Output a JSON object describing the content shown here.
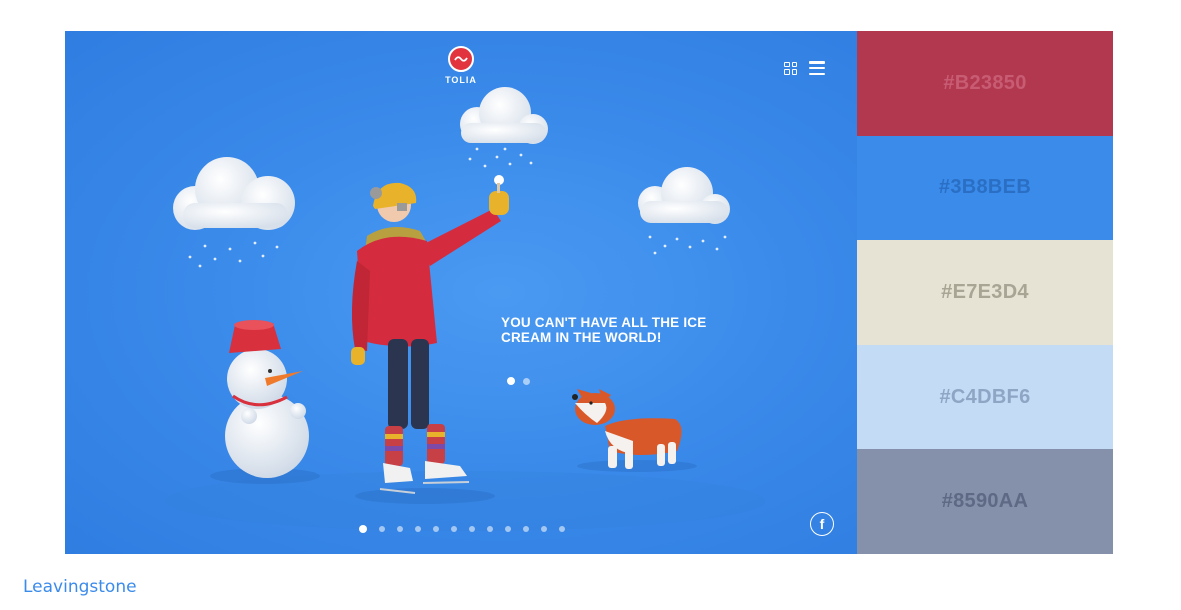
{
  "hero": {
    "brand": "TOLIA",
    "headline": "YOU CAN'T HAVE ALL THE ICE CREAM IN THE WORLD!",
    "slide_dots": {
      "count": 2,
      "active": 0
    },
    "page_dots": {
      "count": 12,
      "active": 0
    },
    "facebook_label": "f",
    "icons": [
      "tolia-logo-icon",
      "grid-view-icon",
      "hamburger-menu-icon",
      "facebook-icon"
    ]
  },
  "palette": [
    {
      "hex": "#B23850",
      "text_color": "#c75c72"
    },
    {
      "hex": "#3B8BEB",
      "text_color": "#2a6fc4"
    },
    {
      "hex": "#E7E3D4",
      "text_color": "#a9a595"
    },
    {
      "hex": "#C4DBF6",
      "text_color": "#8ea6c4"
    },
    {
      "hex": "#8590AA",
      "text_color": "#5e6a85"
    }
  ],
  "caption": "Leavingstone"
}
